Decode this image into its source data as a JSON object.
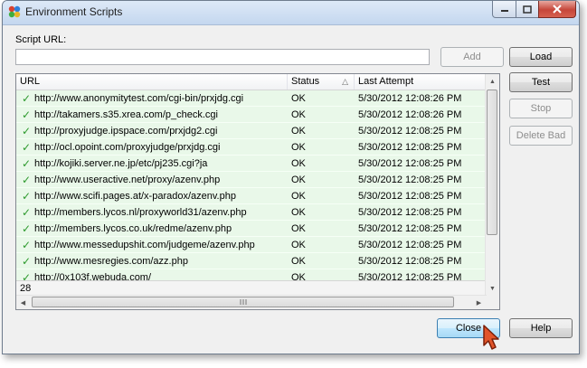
{
  "window": {
    "title": "Environment Scripts"
  },
  "form": {
    "script_url_label": "Script URL:",
    "script_url_value": "",
    "add_label": "Add",
    "load_label": "Load",
    "test_label": "Test",
    "stop_label": "Stop",
    "delete_bad_label": "Delete Bad",
    "close_label": "Close",
    "help_label": "Help"
  },
  "table": {
    "columns": [
      "URL",
      "Status",
      "Last Attempt"
    ],
    "sort_indicator": "△",
    "rows": [
      {
        "url": "http://www.anonymitytest.com/cgi-bin/prxjdg.cgi",
        "status": "OK",
        "last": "5/30/2012 12:08:26 PM"
      },
      {
        "url": "http://takamers.s35.xrea.com/p_check.cgi",
        "status": "OK",
        "last": "5/30/2012 12:08:26 PM"
      },
      {
        "url": "http://proxyjudge.ipspace.com/prxjdg2.cgi",
        "status": "OK",
        "last": "5/30/2012 12:08:25 PM"
      },
      {
        "url": "http://ocl.opoint.com/proxyjudge/prxjdg.cgi",
        "status": "OK",
        "last": "5/30/2012 12:08:25 PM"
      },
      {
        "url": "http://kojiki.server.ne.jp/etc/pj235.cgi?ja",
        "status": "OK",
        "last": "5/30/2012 12:08:25 PM"
      },
      {
        "url": "http://www.useractive.net/proxy/azenv.php",
        "status": "OK",
        "last": "5/30/2012 12:08:25 PM"
      },
      {
        "url": "http://www.scifi.pages.at/x-paradox/azenv.php",
        "status": "OK",
        "last": "5/30/2012 12:08:25 PM"
      },
      {
        "url": "http://members.lycos.nl/proxyworld31/azenv.php",
        "status": "OK",
        "last": "5/30/2012 12:08:25 PM"
      },
      {
        "url": "http://members.lycos.co.uk/redme/azenv.php",
        "status": "OK",
        "last": "5/30/2012 12:08:25 PM"
      },
      {
        "url": "http://www.messedupshit.com/judgeme/azenv.php",
        "status": "OK",
        "last": "5/30/2012 12:08:25 PM"
      },
      {
        "url": "http://www.mesregies.com/azz.php",
        "status": "OK",
        "last": "5/30/2012 12:08:25 PM"
      },
      {
        "url": "http://0x103f.webuda.com/",
        "status": "OK",
        "last": "5/30/2012 12:08:25 PM"
      }
    ],
    "count": "28"
  },
  "colors": {
    "row_ok": "#e9f8e9",
    "check": "#2d9a2d"
  }
}
